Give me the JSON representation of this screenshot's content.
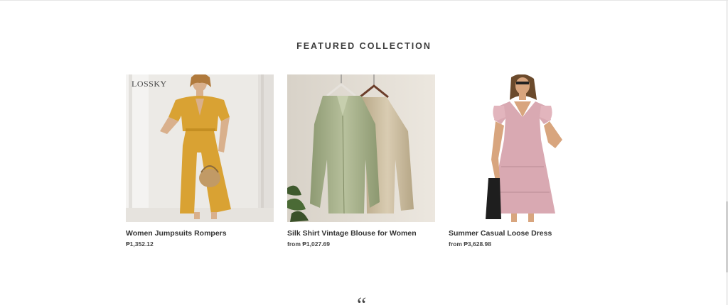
{
  "section": {
    "title": "FEATURED COLLECTION"
  },
  "products": [
    {
      "title": "Women Jumpsuits Rompers",
      "price": "₱1,352.12",
      "image_icon": "yellow-jumpsuit-photo",
      "watermark": "LOSSKY"
    },
    {
      "title": "Silk Shirt Vintage Blouse for Women",
      "price": "from ₱1,027.69",
      "image_icon": "silk-blouses-on-hangers-photo"
    },
    {
      "title": "Summer Casual Loose Dress",
      "price": "from ₱3,628.98",
      "image_icon": "pink-dress-photo"
    }
  ],
  "testimonial": {
    "quote_glyph": "“"
  },
  "colors": {
    "jumpsuit": "#d9a233",
    "blouse_green": "#a9b48f",
    "blouse_beige": "#c9b89a",
    "dress_pink": "#d9a9b2"
  }
}
